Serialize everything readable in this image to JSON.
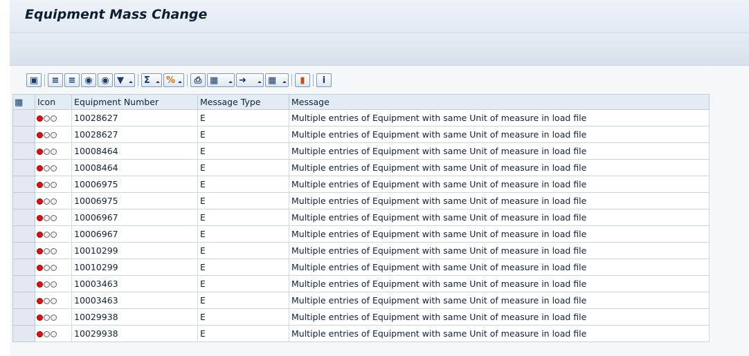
{
  "window": {
    "title": "Equipment Mass Change"
  },
  "toolbar": {
    "icons": [
      "details-icon",
      "sort-ascending-icon",
      "sort-descending-icon",
      "find-icon",
      "find-next-icon",
      "filter-icon",
      "sum-icon",
      "subtotal-icon",
      "print-icon",
      "views-icon",
      "export-icon",
      "layout-icon",
      "graphic-icon",
      "info-icon"
    ]
  },
  "grid": {
    "headers": {
      "icon": "Icon",
      "equipment_number": "Equipment Number",
      "message_type": "Message Type",
      "message": "Message"
    },
    "rows": [
      {
        "equipment_number": "10028627",
        "message_type": "E",
        "message": "Multiple entries of Equipment with same Unit of measure in load file"
      },
      {
        "equipment_number": "10028627",
        "message_type": "E",
        "message": "Multiple entries of Equipment with same Unit of measure in load file"
      },
      {
        "equipment_number": "10008464",
        "message_type": "E",
        "message": "Multiple entries of Equipment with same Unit of measure in load file"
      },
      {
        "equipment_number": "10008464",
        "message_type": "E",
        "message": "Multiple entries of Equipment with same Unit of measure in load file"
      },
      {
        "equipment_number": "10006975",
        "message_type": "E",
        "message": "Multiple entries of Equipment with same Unit of measure in load file"
      },
      {
        "equipment_number": "10006975",
        "message_type": "E",
        "message": "Multiple entries of Equipment with same Unit of measure in load file"
      },
      {
        "equipment_number": "10006967",
        "message_type": "E",
        "message": "Multiple entries of Equipment with same Unit of measure in load file"
      },
      {
        "equipment_number": "10006967",
        "message_type": "E",
        "message": "Multiple entries of Equipment with same Unit of measure in load file"
      },
      {
        "equipment_number": "10010299",
        "message_type": "E",
        "message": "Multiple entries of Equipment with same Unit of measure in load file"
      },
      {
        "equipment_number": "10010299",
        "message_type": "E",
        "message": "Multiple entries of Equipment with same Unit of measure in load file"
      },
      {
        "equipment_number": "10003463",
        "message_type": "E",
        "message": "Multiple entries of Equipment with same Unit of measure in load file"
      },
      {
        "equipment_number": "10003463",
        "message_type": "E",
        "message": "Multiple entries of Equipment with same Unit of measure in load file"
      },
      {
        "equipment_number": "10029938",
        "message_type": "E",
        "message": "Multiple entries of Equipment with same Unit of measure in load file"
      },
      {
        "equipment_number": "10029938",
        "message_type": "E",
        "message": "Multiple entries of Equipment with same Unit of measure in load file"
      }
    ]
  },
  "colors": {
    "status_red": "#e0101a",
    "header_bg": "#e3ebf3",
    "accent": "#0e1f33"
  }
}
